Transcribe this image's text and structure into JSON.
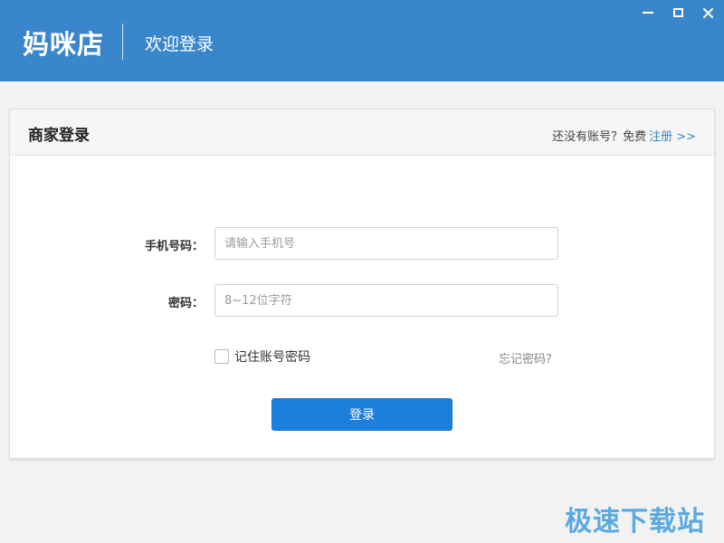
{
  "header": {
    "brand": "妈咪店",
    "welcome": "欢迎登录",
    "window_controls": [
      "minimize-icon",
      "maximize-icon",
      "close-icon"
    ]
  },
  "login_card": {
    "title": "商家登录",
    "register_prompt": "还没有账号？免费",
    "register_link": "注册 >>",
    "phone": {
      "label": "手机号码：",
      "value": "",
      "placeholder": "请输入手机号"
    },
    "password": {
      "label": "密码：",
      "value": "",
      "placeholder": "8~12位字符"
    },
    "remember": {
      "label": "记住账号密码",
      "checked": false
    },
    "forgot": "忘记密码?",
    "submit": "登录"
  },
  "watermark": "极速下载站",
  "colors": {
    "header_bg": "#3a86cc",
    "button_bg": "#1d7fdc",
    "link": "#3a86cc"
  }
}
